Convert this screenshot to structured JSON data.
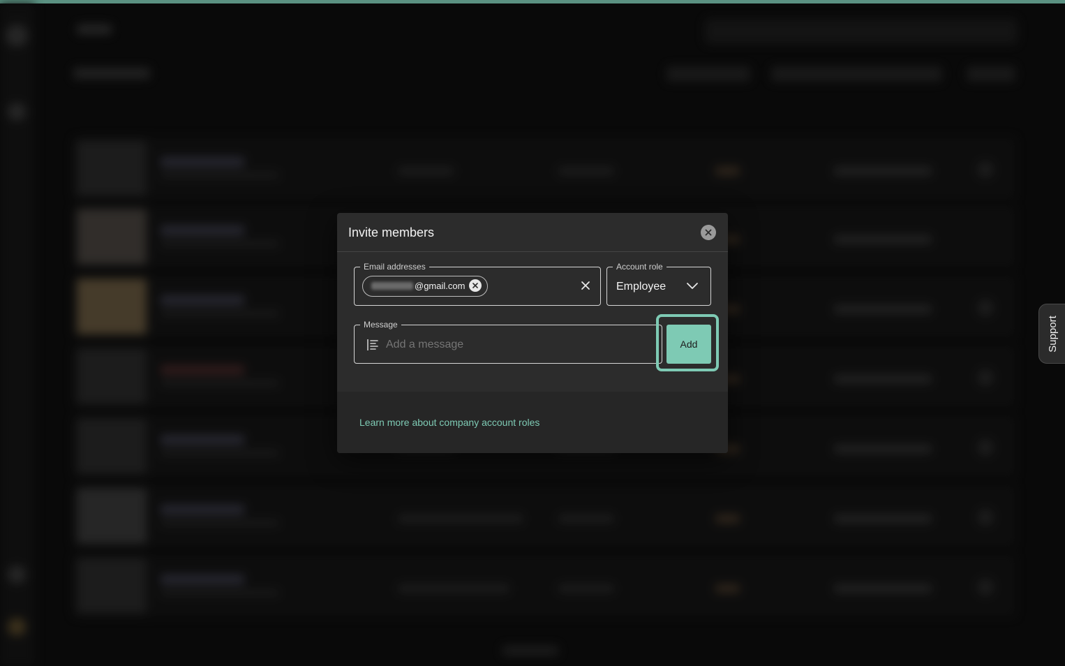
{
  "accent_color": "#7ecab4",
  "modal": {
    "title": "Invite members",
    "email_field": {
      "label": "Email addresses",
      "chip_text": "@gmail.com"
    },
    "role_field": {
      "label": "Account role",
      "value": "Employee"
    },
    "message_field": {
      "label": "Message",
      "placeholder": "Add a message"
    },
    "add_button": "Add",
    "footer_link": "Learn more about company account roles"
  },
  "support_tab": "Support",
  "icons": {
    "close": "close-circle-icon",
    "chip_remove": "remove-chip-icon",
    "clear": "clear-x-icon",
    "dropdown": "chevron-down-icon",
    "message": "text-align-icon"
  }
}
